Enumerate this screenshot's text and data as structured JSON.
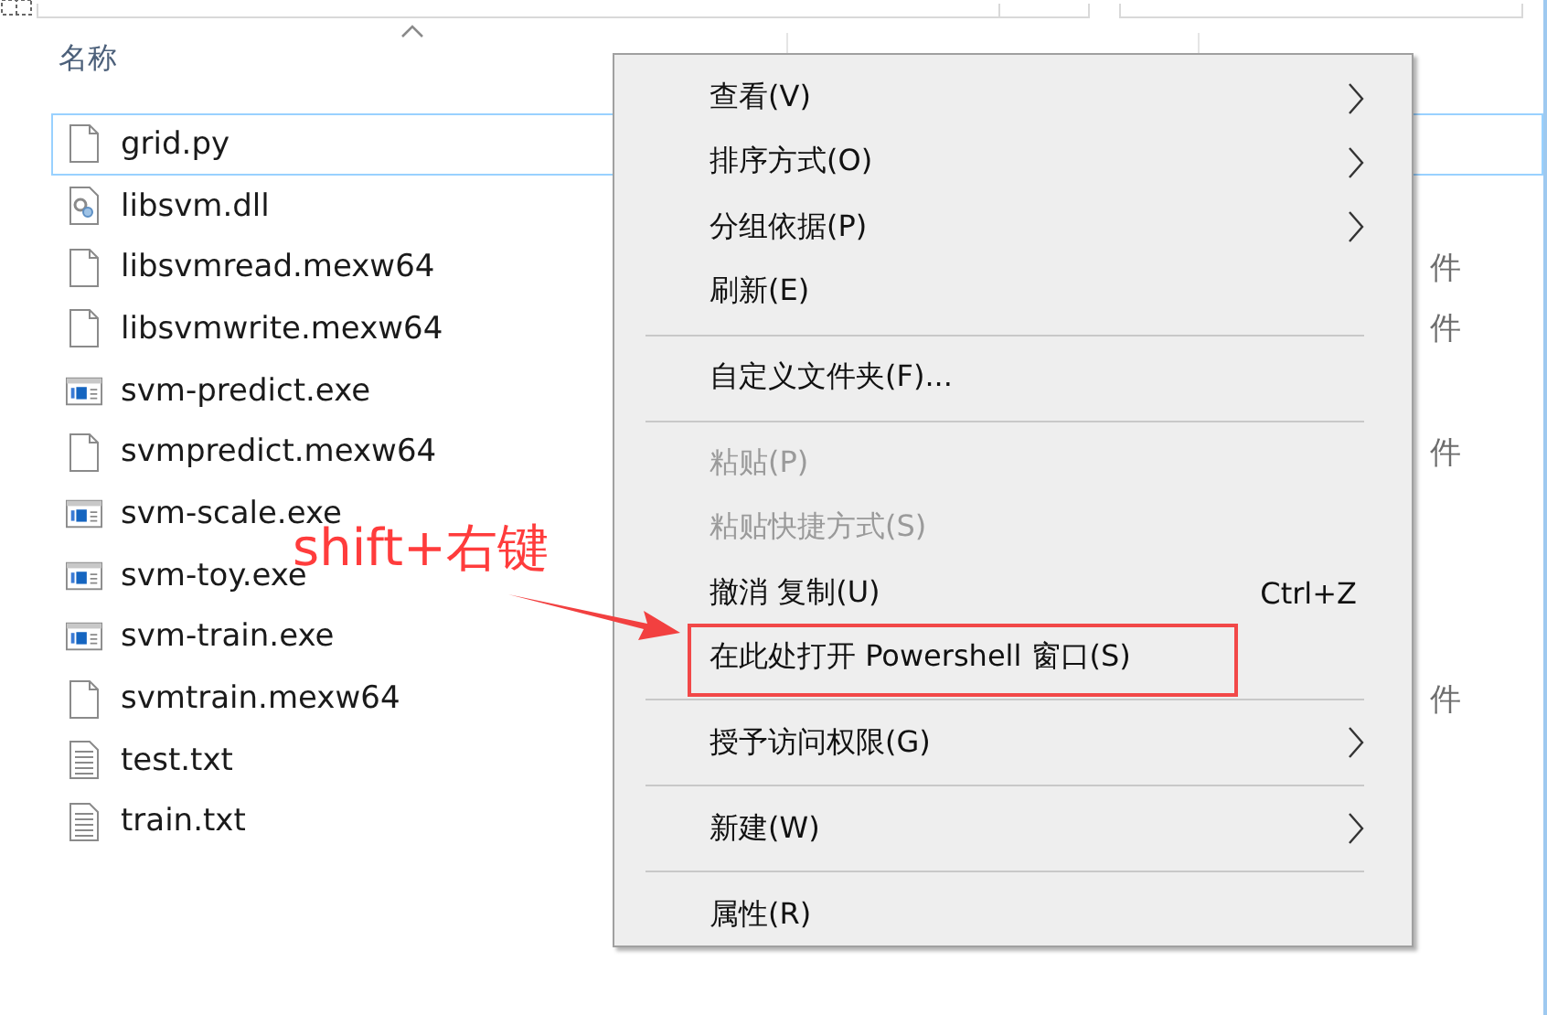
{
  "columns": [
    {
      "label": "名称",
      "sorted": true
    }
  ],
  "files": [
    {
      "name": "grid.py",
      "kind": "blank",
      "selected": true
    },
    {
      "name": "libsvm.dll",
      "kind": "dll",
      "selected": false
    },
    {
      "name": "libsvmread.mexw64",
      "kind": "blank",
      "selected": false,
      "column_3": "件"
    },
    {
      "name": "libsvmwrite.mexw64",
      "kind": "blank",
      "selected": false,
      "column_3": "件"
    },
    {
      "name": "svm-predict.exe",
      "kind": "exe",
      "selected": false
    },
    {
      "name": "svmpredict.mexw64",
      "kind": "blank",
      "selected": false,
      "column_3": "件"
    },
    {
      "name": "svm-scale.exe",
      "kind": "exe",
      "selected": false
    },
    {
      "name": "svm-toy.exe",
      "kind": "exe",
      "selected": false
    },
    {
      "name": "svm-train.exe",
      "kind": "exe",
      "selected": false
    },
    {
      "name": "svmtrain.mexw64",
      "kind": "blank",
      "selected": false,
      "column_3": "件"
    },
    {
      "name": "test.txt",
      "kind": "text",
      "selected": false
    },
    {
      "name": "train.txt",
      "kind": "text",
      "selected": false
    }
  ],
  "context_menu": [
    {
      "kind": "item",
      "label": "查看(V)",
      "submenu": true,
      "disabled": false
    },
    {
      "kind": "item",
      "label": "排序方式(O)",
      "submenu": true,
      "disabled": false
    },
    {
      "kind": "item",
      "label": "分组依据(P)",
      "submenu": true,
      "disabled": false
    },
    {
      "kind": "item",
      "label": "刷新(E)",
      "submenu": false,
      "disabled": false
    },
    {
      "kind": "separator"
    },
    {
      "kind": "item",
      "label": "自定义文件夹(F)...",
      "submenu": false,
      "disabled": false
    },
    {
      "kind": "separator"
    },
    {
      "kind": "item",
      "label": "粘贴(P)",
      "submenu": false,
      "disabled": true
    },
    {
      "kind": "item",
      "label": "粘贴快捷方式(S)",
      "submenu": false,
      "disabled": true
    },
    {
      "kind": "item",
      "label": "撤消 复制(U)",
      "shortcut": "Ctrl+Z",
      "submenu": false,
      "disabled": false
    },
    {
      "kind": "item",
      "label": "在此处打开 Powershell 窗口(S)",
      "submenu": false,
      "disabled": false,
      "annotated": true
    },
    {
      "kind": "separator"
    },
    {
      "kind": "item",
      "label": "授予访问权限(G)",
      "submenu": true,
      "disabled": false
    },
    {
      "kind": "separator"
    },
    {
      "kind": "item",
      "label": "新建(W)",
      "submenu": true,
      "disabled": false
    },
    {
      "kind": "separator"
    },
    {
      "kind": "item",
      "label": "属性(R)",
      "submenu": false,
      "disabled": false
    }
  ],
  "annotation": {
    "text": "shift+右键"
  }
}
